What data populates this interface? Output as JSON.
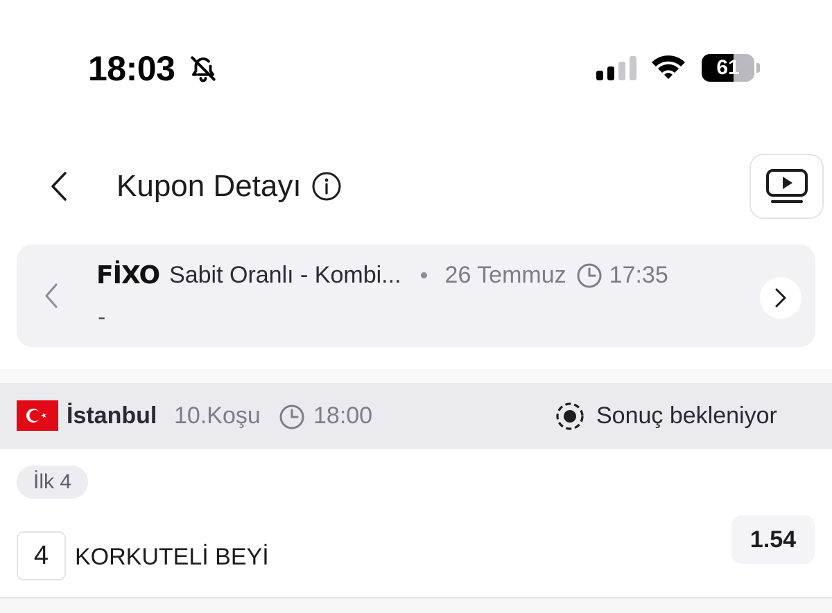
{
  "status_bar": {
    "time": "18:03",
    "battery_percent": "61",
    "battery_level": 0.61,
    "signal_bars_active": 2,
    "signal_bars_total": 4,
    "icons": [
      "bell-slash-icon",
      "cellular-signal-icon",
      "wifi-icon",
      "battery-icon"
    ]
  },
  "header": {
    "title": "Kupon Detayı",
    "icons": [
      "chevron-left-icon",
      "info-icon",
      "video-play-icon"
    ]
  },
  "coupon": {
    "logo": "FİXO",
    "game_name": "Sabit Oranlı - Kombi...",
    "date": "26 Temmuz",
    "time": "17:35",
    "sub_line": "-",
    "icons": [
      "chevron-left-icon",
      "clock-icon",
      "chevron-right-icon"
    ]
  },
  "race": {
    "city": "İstanbul",
    "race_number": "10.Koşu",
    "time": "18:00",
    "status": "Sonuç bekleniyor",
    "icons": [
      "turkey-flag-icon",
      "clock-icon",
      "pending-status-icon"
    ]
  },
  "bet": {
    "type_label": "İlk 4",
    "selections": [
      {
        "number": "4",
        "name": "KORKUTELİ BEYİ",
        "odds": "1.54"
      }
    ]
  },
  "colors": {
    "card_bg": "#f2f2f4",
    "race_row_bg": "#ebebed",
    "muted_text": "#7d7d83",
    "flag_red": "#e30a17"
  }
}
